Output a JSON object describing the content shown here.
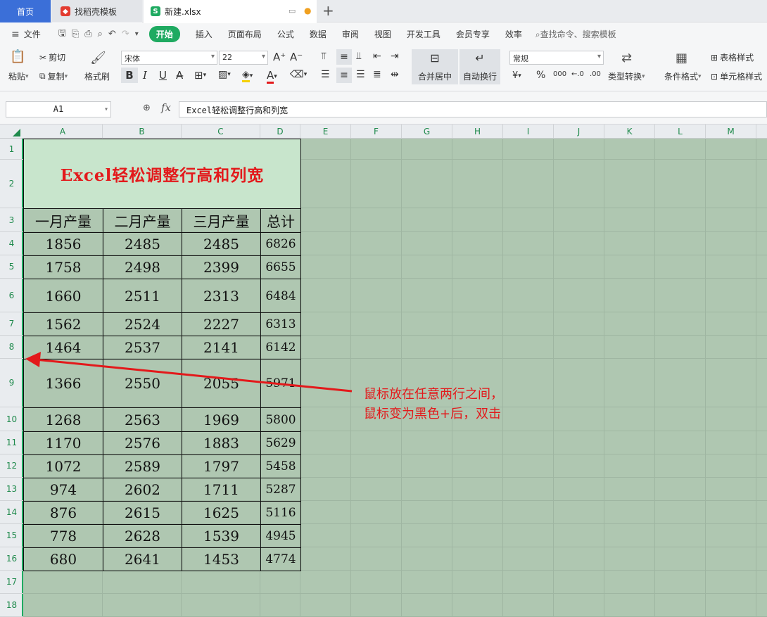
{
  "tabs": {
    "home": "首页",
    "template": "找稻壳模板",
    "document": "新建.xlsx"
  },
  "menu": {
    "file": "文件",
    "items": [
      "开始",
      "插入",
      "页面布局",
      "公式",
      "数据",
      "审阅",
      "视图",
      "开发工具",
      "会员专享",
      "效率"
    ],
    "search": "查找命令、搜索模板"
  },
  "ribbon": {
    "paste": "粘贴",
    "cut": "剪切",
    "copy": "复制",
    "format_painter": "格式刷",
    "font_name": "宋体",
    "font_size": "22",
    "merge_center": "合并居中",
    "wrap_text": "自动换行",
    "number_format": "常规",
    "type_convert": "类型转换",
    "cond_format": "条件格式",
    "table_style": "表格样式",
    "cell_style": "单元格样式"
  },
  "formula_bar": {
    "cell_ref": "A1",
    "content": "Excel轻松调整行高和列宽"
  },
  "columns": [
    "A",
    "B",
    "C",
    "D",
    "E",
    "F",
    "G",
    "H",
    "I",
    "J",
    "K",
    "L",
    "M"
  ],
  "rows": [
    "1",
    "2",
    "3",
    "4",
    "5",
    "6",
    "7",
    "8",
    "9",
    "10",
    "11",
    "12",
    "13",
    "14",
    "15",
    "16",
    "17",
    "18"
  ],
  "table": {
    "title": "Excel轻松调整行高和列宽",
    "headers": [
      "一月产量",
      "二月产量",
      "三月产量",
      "总计"
    ],
    "data": [
      [
        "1856",
        "2485",
        "2485",
        "6826"
      ],
      [
        "1758",
        "2498",
        "2399",
        "6655"
      ],
      [
        "1660",
        "2511",
        "2313",
        "6484"
      ],
      [
        "1562",
        "2524",
        "2227",
        "6313"
      ],
      [
        "1464",
        "2537",
        "2141",
        "6142"
      ],
      [
        "1366",
        "2550",
        "2055",
        "5971"
      ],
      [
        "1268",
        "2563",
        "1969",
        "5800"
      ],
      [
        "1170",
        "2576",
        "1883",
        "5629"
      ],
      [
        "1072",
        "2589",
        "1797",
        "5458"
      ],
      [
        "974",
        "2602",
        "1711",
        "5287"
      ],
      [
        "876",
        "2615",
        "1625",
        "5116"
      ],
      [
        "778",
        "2628",
        "1539",
        "4945"
      ],
      [
        "680",
        "2641",
        "1453",
        "4774"
      ]
    ]
  },
  "annotation": {
    "line1": "鼠标放在任意两行之间，",
    "line2": "鼠标变为黑色+后，双击"
  },
  "colors": {
    "accent": "#1faa61",
    "sheet_bg": "#afc7b1",
    "title_fill": "#c8e5cc",
    "title_text": "#e3191b",
    "annotation": "#e3191b"
  }
}
